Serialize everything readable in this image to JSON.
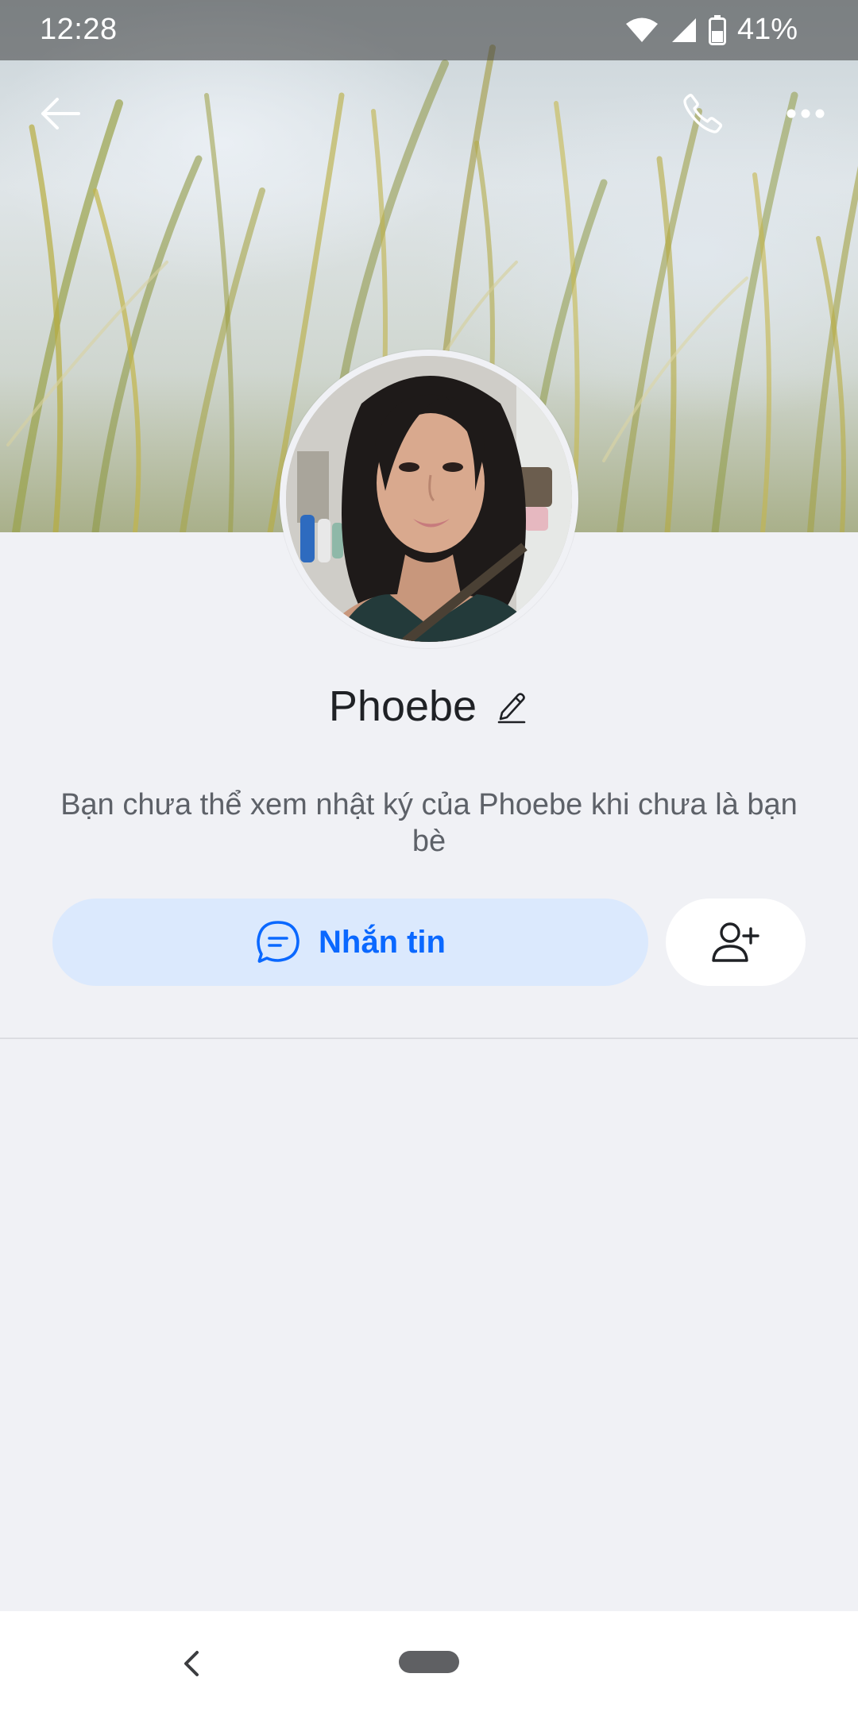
{
  "status_bar": {
    "time": "12:28",
    "battery": "41%",
    "icons": [
      "wifi-icon",
      "cell-signal-icon",
      "battery-icon"
    ]
  },
  "top_bar": {
    "icons": [
      "back-arrow-icon",
      "phone-icon",
      "more-dots-icon"
    ]
  },
  "profile": {
    "name": "Phoebe",
    "edit_icon": "pencil-icon",
    "info_text": "Bạn chưa thể xem nhật ký của Phoebe khi chưa là bạn bè"
  },
  "actions": {
    "message_label": "Nhắn tin",
    "message_icon": "chat-bubble-icon",
    "add_friend_icon": "add-user-icon"
  },
  "nav_bar": {
    "icons": [
      "nav-back-icon",
      "home-pill"
    ]
  },
  "colors": {
    "background": "#f0f1f5",
    "accent": "#0a68ff",
    "message_button_bg": "#dbe9fd",
    "text_primary": "#1f2125",
    "text_secondary": "#5d6168"
  }
}
